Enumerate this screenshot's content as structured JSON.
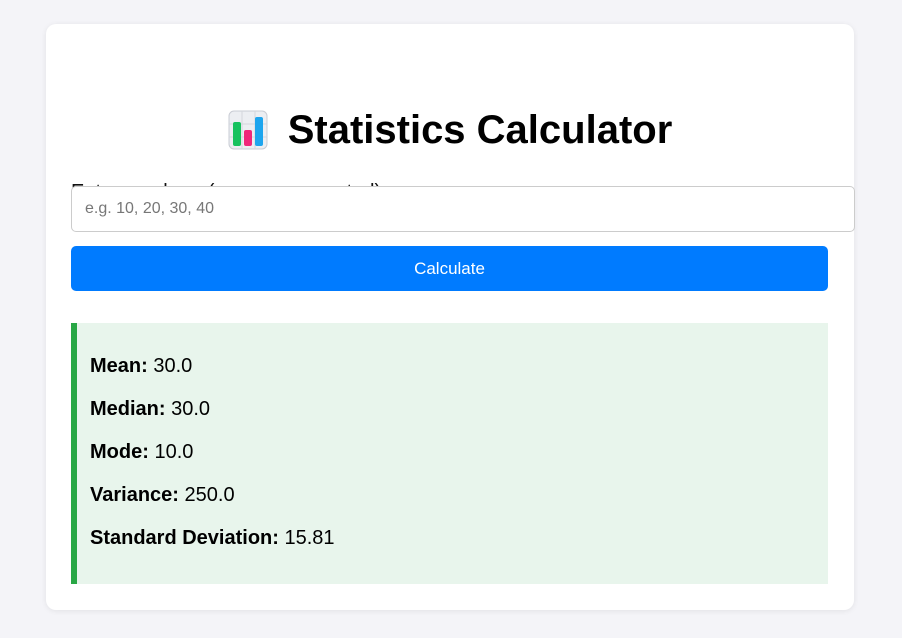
{
  "header": {
    "icon": "bar-chart-icon",
    "title": "Statistics Calculator"
  },
  "form": {
    "label": "Enter numbers (comma separated):",
    "input_value": "",
    "input_placeholder": "e.g. 10, 20, 30, 40",
    "button_label": "Calculate"
  },
  "results": {
    "mean_label": "Mean:",
    "mean_value": "30.0",
    "median_label": "Median:",
    "median_value": "30.0",
    "mode_label": "Mode:",
    "mode_value": "10.0",
    "variance_label": "Variance:",
    "variance_value": "250.0",
    "std_label": "Standard Deviation:",
    "std_value": "15.81"
  },
  "colors": {
    "page_bg": "#f4f4f8",
    "button": "#007bff",
    "results_bg": "#e8f5ec",
    "results_border": "#28a745"
  }
}
